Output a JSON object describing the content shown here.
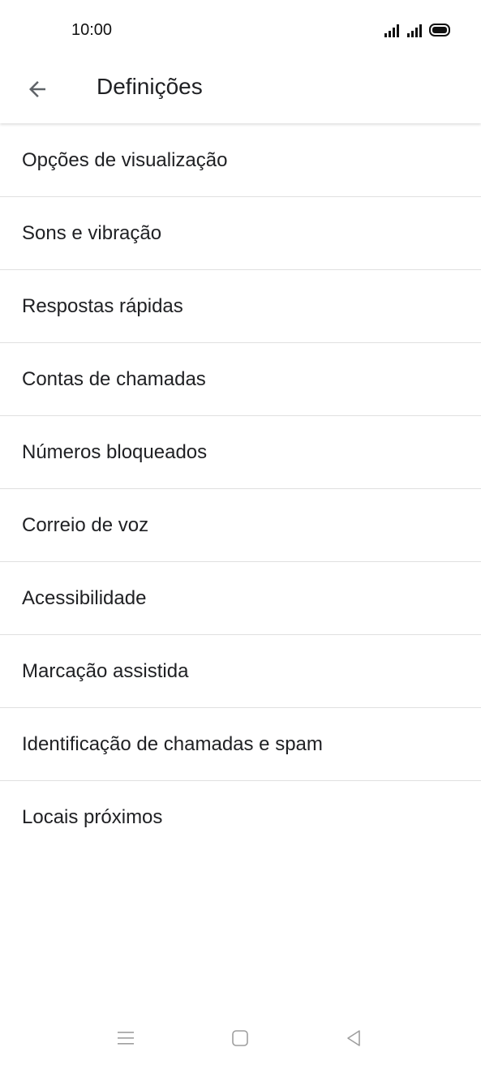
{
  "status_bar": {
    "time": "10:00",
    "icons": [
      "signal-icon",
      "signal-icon",
      "battery-icon"
    ]
  },
  "app_bar": {
    "title": "Definições",
    "back_icon": "arrow-left-icon"
  },
  "settings": {
    "items": [
      {
        "label": "Opções de visualização"
      },
      {
        "label": "Sons e vibração"
      },
      {
        "label": "Respostas rápidas"
      },
      {
        "label": "Contas de chamadas"
      },
      {
        "label": "Números bloqueados"
      },
      {
        "label": "Correio de voz"
      },
      {
        "label": "Acessibilidade"
      },
      {
        "label": "Marcação assistida"
      },
      {
        "label": "Identificação de chamadas e spam"
      },
      {
        "label": "Locais próximos"
      }
    ]
  },
  "nav_bar": {
    "icons": [
      "menu-icon",
      "home-icon",
      "back-triangle-icon"
    ]
  },
  "colors": {
    "text_primary": "#202124",
    "divider": "#e0e0e0",
    "nav_icon": "#9e9e9e"
  }
}
